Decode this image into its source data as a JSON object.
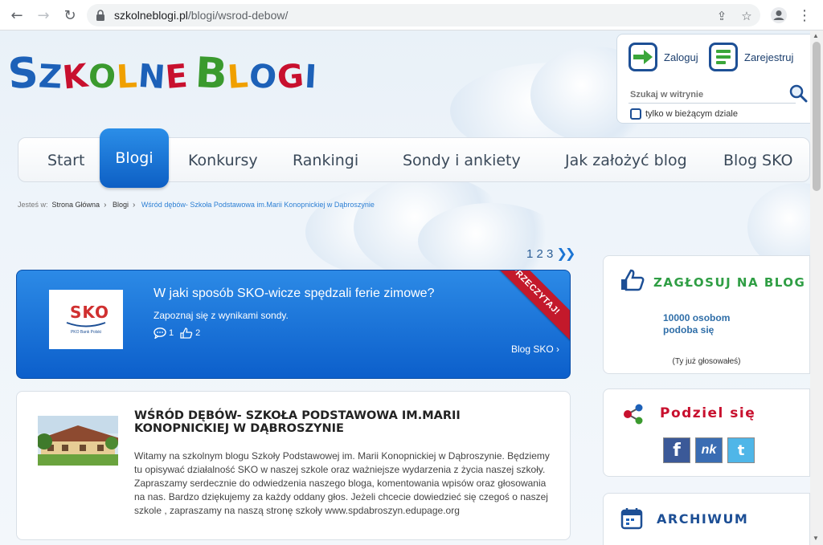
{
  "browser": {
    "url_domain": "szkolneblogi.pl",
    "url_path": "/blogi/wsrod-debow/"
  },
  "logo": {
    "letters": [
      "S",
      "z",
      "k",
      "o",
      "l",
      "n",
      "e",
      " ",
      "B",
      "l",
      "o",
      "g",
      "i"
    ],
    "colors": [
      "#1d61b8",
      "#1d61b8",
      "#c8102e",
      "#3a9a2e",
      "#f0a000",
      "#1d61b8",
      "#c8102e",
      " ",
      "#3a9a2e",
      "#f0a000",
      "#1d61b8",
      "#c8102e",
      "#1d61b8"
    ]
  },
  "account": {
    "login_label": "Zaloguj",
    "register_label": "Zarejestruj",
    "search_placeholder": "Szukaj w witrynie",
    "scope_label": "tylko w bieżącym dziale"
  },
  "nav": {
    "items": [
      "Start",
      "Blogi",
      "Konkursy",
      "Rankingi",
      "Sondy i ankiety",
      "Jak założyć blog",
      "Blog SKO"
    ],
    "active": "Blogi"
  },
  "breadcrumb": {
    "prefix": "Jesteś w:",
    "items": [
      "Strona Główna",
      "Blogi",
      "Wśród dębów- Szkoła Podstawowa im.Marii Konopnickiej w Dąbroszynie"
    ]
  },
  "pager": {
    "pages": [
      "1",
      "2",
      "3"
    ],
    "next": "»"
  },
  "featured": {
    "ribbon": "PRZECZYTAJ!",
    "thumb_text": "SKO",
    "thumb_caption": "PKO Bank Polski",
    "title": "W jaki sposób SKO-wicze spędzali ferie zimowe?",
    "subtitle": "Zapoznaj się z wynikami sondy.",
    "comments": "1",
    "likes": "2",
    "link": "Blog SKO ›"
  },
  "post": {
    "title": "Wśród dębów- Szkoła Podstawowa im.Marii Konopnickiej w Dąbroszynie",
    "body": "Witamy na szkolnym blogu Szkoły Podstawowej im. Marii Konopnickiej w Dąbroszynie. Będziemy tu opisywać działalność SKO w naszej szkole oraz ważniejsze wydarzenia z życia naszej szkoły. Zapraszamy serdecznie do odwiedzenia naszego bloga, komentowania wpisów oraz głosowania na nas. Bardzo dziękujemy za każdy oddany głos. Jeżeli chcecie dowiedzieć się czegoś o naszej szkole , zapraszamy na naszą stronę szkoły www.spdabroszyn.edupage.org"
  },
  "sidebar": {
    "vote": {
      "title": "Zagłosuj na blog",
      "count_line1": "10000 osobom",
      "count_line2": "podoba się",
      "voted": "(Ty już głosowałeś)"
    },
    "share": {
      "title": "Podziel się",
      "buttons": [
        "f",
        "nk",
        "t"
      ]
    },
    "archive": {
      "title": "Archiwum"
    }
  },
  "colors": {
    "accent_blue": "#0d5fc4",
    "ribbon_red": "#c3192b",
    "vote_title": "#2f9e44"
  }
}
